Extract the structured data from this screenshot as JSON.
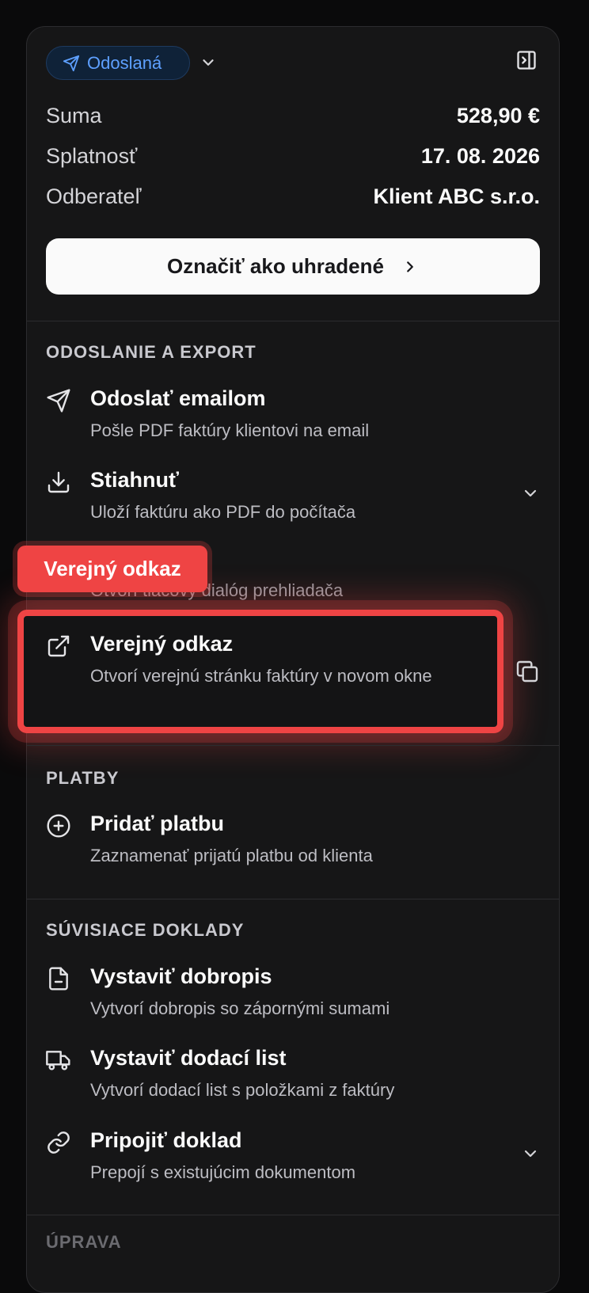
{
  "status": {
    "label": "Odoslaná",
    "color": "#5ea0ff"
  },
  "summary": [
    {
      "label": "Suma",
      "value": "528,90 €"
    },
    {
      "label": "Splatnosť",
      "value": "17. 08. 2026"
    },
    {
      "label": "Odberateľ",
      "value": "Klient ABC s.r.o."
    }
  ],
  "cta": {
    "label": "Označiť ako uhradené"
  },
  "sections": {
    "export": {
      "title": "ODOSLANIE A EXPORT",
      "items": [
        {
          "title": "Odoslať emailom",
          "desc": "Pošle PDF faktúry klientovi na email",
          "icon": "send-icon"
        },
        {
          "title": "Stiahnuť",
          "desc": "Uloží faktúru ako PDF do počítača",
          "icon": "download-icon"
        },
        {
          "title": "",
          "desc": "Otvorí tlačový dialóg prehliadača",
          "icon": "printer-icon"
        },
        {
          "title": "Verejný odkaz",
          "desc": "Otvorí verejnú stránku faktúry v novom okne",
          "icon": "external-link-icon"
        }
      ]
    },
    "payments": {
      "title": "PLATBY",
      "items": [
        {
          "title": "Pridať platbu",
          "desc": "Zaznamenať prijatú platbu od klienta",
          "icon": "plus-circle-icon"
        }
      ]
    },
    "related": {
      "title": "SÚVISIACE DOKLADY",
      "items": [
        {
          "title": "Vystaviť dobropis",
          "desc": "Vytvorí dobropis so zápornými sumami",
          "icon": "file-minus-icon"
        },
        {
          "title": "Vystaviť dodací list",
          "desc": "Vytvorí dodací list s položkami z faktúry",
          "icon": "truck-icon"
        },
        {
          "title": "Pripojiť doklad",
          "desc": "Prepojí s existujúcim dokumentom",
          "icon": "link-icon"
        }
      ]
    },
    "next": {
      "title": "ÚPRAVA"
    }
  },
  "highlight": {
    "tag": "Verejný odkaz",
    "color": "#ef4444"
  }
}
